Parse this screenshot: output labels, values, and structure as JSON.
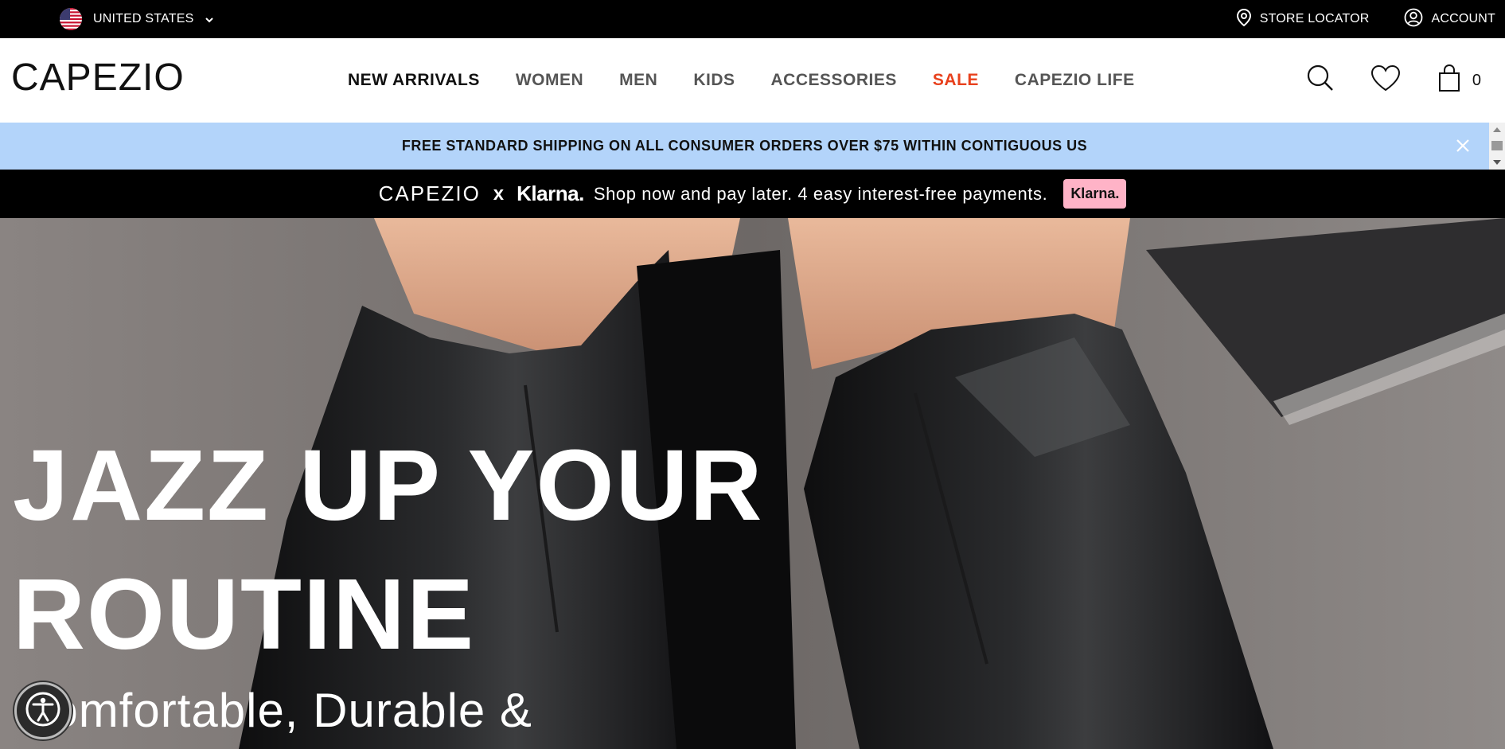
{
  "topbar": {
    "region": {
      "label": "UNITED STATES",
      "icon": "us-flag-icon"
    },
    "store_locator": "STORE LOCATOR",
    "account": "ACCOUNT"
  },
  "header": {
    "logo": "CAPEZIO",
    "nav": [
      {
        "label": "NEW ARRIVALS",
        "state": "active"
      },
      {
        "label": "WOMEN"
      },
      {
        "label": "MEN"
      },
      {
        "label": "KIDS"
      },
      {
        "label": "ACCESSORIES"
      },
      {
        "label": "SALE",
        "color": "#e8411d"
      },
      {
        "label": "CAPEZIO LIFE"
      }
    ],
    "cart_count": "0"
  },
  "shipping_banner": {
    "text": "FREE STANDARD SHIPPING ON ALL CONSUMER ORDERS OVER $75 WITHIN CONTIGUOUS US",
    "background": "#b3d4fa"
  },
  "klarna_bar": {
    "brand": "CAPEZIO",
    "x": "x",
    "partner": "Klarna.",
    "message": "Shop now and pay later. 4 easy interest-free payments.",
    "badge": "Klarna."
  },
  "hero": {
    "headline": "JAZZ UP YOUR ROUTINE",
    "subheadline": "Comfortable, Durable &"
  }
}
